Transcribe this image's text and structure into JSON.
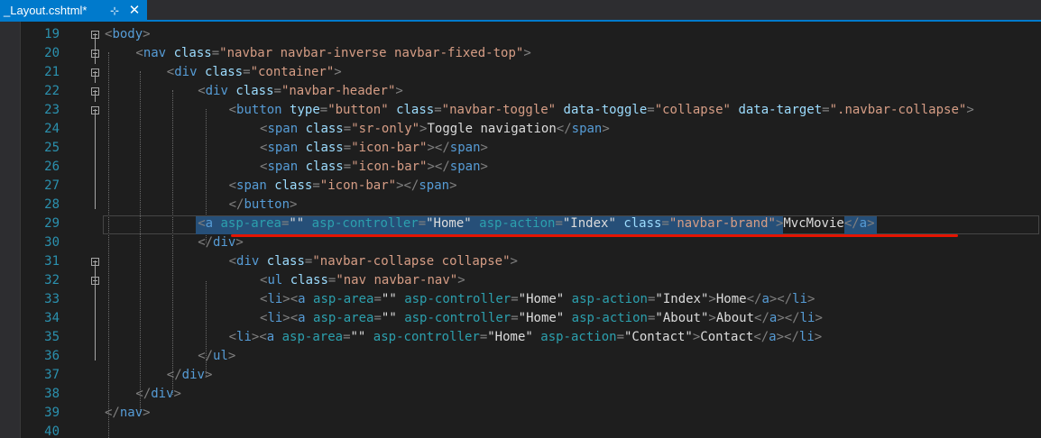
{
  "tab": {
    "title": "_Layout.cshtml*",
    "pin_glyph": "⊹",
    "close_glyph": "✕"
  },
  "colors": {
    "accent": "#007acc",
    "editor_bg": "#1e1e1e",
    "line_number": "#2b91af",
    "tag": "#569cd6",
    "attribute": "#9cdcfe",
    "attribute_value": "#d69d85",
    "selection": "#264f78",
    "underline": "#e51400"
  },
  "line_numbers": [
    "19",
    "20",
    "21",
    "22",
    "23",
    "24",
    "25",
    "26",
    "27",
    "28",
    "29",
    "30",
    "31",
    "32",
    "33",
    "34",
    "35",
    "36",
    "37",
    "38",
    "39",
    "40"
  ],
  "lines": [
    [
      {
        "c": "d",
        "t": "<"
      },
      {
        "c": "t",
        "t": "body"
      },
      {
        "c": "d",
        "t": ">"
      }
    ],
    [
      {
        "c": "d",
        "t": "<"
      },
      {
        "c": "t",
        "t": "nav"
      },
      {
        "c": "tx",
        "t": " "
      },
      {
        "c": "a",
        "t": "class"
      },
      {
        "c": "d",
        "t": "="
      },
      {
        "c": "v",
        "t": "\"navbar navbar-inverse navbar-fixed-top\""
      },
      {
        "c": "d",
        "t": ">"
      }
    ],
    [
      {
        "c": "d",
        "t": "<"
      },
      {
        "c": "t",
        "t": "div"
      },
      {
        "c": "tx",
        "t": " "
      },
      {
        "c": "a",
        "t": "class"
      },
      {
        "c": "d",
        "t": "="
      },
      {
        "c": "v",
        "t": "\"container\""
      },
      {
        "c": "d",
        "t": ">"
      }
    ],
    [
      {
        "c": "d",
        "t": "<"
      },
      {
        "c": "t",
        "t": "div"
      },
      {
        "c": "tx",
        "t": " "
      },
      {
        "c": "a",
        "t": "class"
      },
      {
        "c": "d",
        "t": "="
      },
      {
        "c": "v",
        "t": "\"navbar-header\""
      },
      {
        "c": "d",
        "t": ">"
      }
    ],
    [
      {
        "c": "d",
        "t": "<"
      },
      {
        "c": "t",
        "t": "button"
      },
      {
        "c": "tx",
        "t": " "
      },
      {
        "c": "a",
        "t": "type"
      },
      {
        "c": "d",
        "t": "="
      },
      {
        "c": "v",
        "t": "\"button\""
      },
      {
        "c": "tx",
        "t": " "
      },
      {
        "c": "a",
        "t": "class"
      },
      {
        "c": "d",
        "t": "="
      },
      {
        "c": "v",
        "t": "\"navbar-toggle\""
      },
      {
        "c": "tx",
        "t": " "
      },
      {
        "c": "a",
        "t": "data-toggle"
      },
      {
        "c": "d",
        "t": "="
      },
      {
        "c": "v",
        "t": "\"collapse\""
      },
      {
        "c": "tx",
        "t": " "
      },
      {
        "c": "a",
        "t": "data-target"
      },
      {
        "c": "d",
        "t": "="
      },
      {
        "c": "v",
        "t": "\".navbar-collapse\""
      },
      {
        "c": "d",
        "t": ">"
      }
    ],
    [
      {
        "c": "d",
        "t": "<"
      },
      {
        "c": "t",
        "t": "span"
      },
      {
        "c": "tx",
        "t": " "
      },
      {
        "c": "a",
        "t": "class"
      },
      {
        "c": "d",
        "t": "="
      },
      {
        "c": "v",
        "t": "\"sr-only\""
      },
      {
        "c": "d",
        "t": ">"
      },
      {
        "c": "tx",
        "t": "Toggle navigation"
      },
      {
        "c": "d",
        "t": "</"
      },
      {
        "c": "t",
        "t": "span"
      },
      {
        "c": "d",
        "t": ">"
      }
    ],
    [
      {
        "c": "d",
        "t": "<"
      },
      {
        "c": "t",
        "t": "span"
      },
      {
        "c": "tx",
        "t": " "
      },
      {
        "c": "a",
        "t": "class"
      },
      {
        "c": "d",
        "t": "="
      },
      {
        "c": "v",
        "t": "\"icon-bar\""
      },
      {
        "c": "d",
        "t": "></"
      },
      {
        "c": "t",
        "t": "span"
      },
      {
        "c": "d",
        "t": ">"
      }
    ],
    [
      {
        "c": "d",
        "t": "<"
      },
      {
        "c": "t",
        "t": "span"
      },
      {
        "c": "tx",
        "t": " "
      },
      {
        "c": "a",
        "t": "class"
      },
      {
        "c": "d",
        "t": "="
      },
      {
        "c": "v",
        "t": "\"icon-bar\""
      },
      {
        "c": "d",
        "t": "></"
      },
      {
        "c": "t",
        "t": "span"
      },
      {
        "c": "d",
        "t": ">"
      }
    ],
    [
      {
        "c": "d",
        "t": "<"
      },
      {
        "c": "t",
        "t": "span"
      },
      {
        "c": "tx",
        "t": " "
      },
      {
        "c": "a",
        "t": "class"
      },
      {
        "c": "d",
        "t": "="
      },
      {
        "c": "v",
        "t": "\"icon-bar\""
      },
      {
        "c": "d",
        "t": "></"
      },
      {
        "c": "t",
        "t": "span"
      },
      {
        "c": "d",
        "t": ">"
      }
    ],
    [
      {
        "c": "d",
        "t": "</"
      },
      {
        "c": "t",
        "t": "button"
      },
      {
        "c": "d",
        "t": ">"
      }
    ],
    [
      {
        "c": "d",
        "t": "<"
      },
      {
        "c": "t",
        "t": "a"
      },
      {
        "c": "tx",
        "t": " "
      },
      {
        "c": "h",
        "t": "asp-area"
      },
      {
        "c": "d",
        "t": "="
      },
      {
        "c": "tx",
        "t": "\"\""
      },
      {
        "c": "tx",
        "t": " "
      },
      {
        "c": "h",
        "t": "asp-controller"
      },
      {
        "c": "d",
        "t": "="
      },
      {
        "c": "tx",
        "t": "\"Home\""
      },
      {
        "c": "tx",
        "t": " "
      },
      {
        "c": "h",
        "t": "asp-action"
      },
      {
        "c": "d",
        "t": "="
      },
      {
        "c": "tx",
        "t": "\"Index\""
      },
      {
        "c": "tx",
        "t": " "
      },
      {
        "c": "a",
        "t": "class"
      },
      {
        "c": "d",
        "t": "="
      },
      {
        "c": "v",
        "t": "\"navbar-brand\""
      },
      {
        "c": "d",
        "t": ">"
      },
      {
        "c": "tx",
        "t": "MvcMovie"
      },
      {
        "c": "d",
        "t": "</"
      },
      {
        "c": "t",
        "t": "a"
      },
      {
        "c": "d",
        "t": ">"
      }
    ],
    [
      {
        "c": "d",
        "t": "</"
      },
      {
        "c": "t",
        "t": "div"
      },
      {
        "c": "d",
        "t": ">"
      }
    ],
    [
      {
        "c": "d",
        "t": "<"
      },
      {
        "c": "t",
        "t": "div"
      },
      {
        "c": "tx",
        "t": " "
      },
      {
        "c": "a",
        "t": "class"
      },
      {
        "c": "d",
        "t": "="
      },
      {
        "c": "v",
        "t": "\"navbar-collapse collapse\""
      },
      {
        "c": "d",
        "t": ">"
      }
    ],
    [
      {
        "c": "d",
        "t": "<"
      },
      {
        "c": "t",
        "t": "ul"
      },
      {
        "c": "tx",
        "t": " "
      },
      {
        "c": "a",
        "t": "class"
      },
      {
        "c": "d",
        "t": "="
      },
      {
        "c": "v",
        "t": "\"nav navbar-nav\""
      },
      {
        "c": "d",
        "t": ">"
      }
    ],
    [
      {
        "c": "d",
        "t": "<"
      },
      {
        "c": "t",
        "t": "li"
      },
      {
        "c": "d",
        "t": "><"
      },
      {
        "c": "t",
        "t": "a"
      },
      {
        "c": "tx",
        "t": " "
      },
      {
        "c": "h",
        "t": "asp-area"
      },
      {
        "c": "d",
        "t": "="
      },
      {
        "c": "tx",
        "t": "\"\""
      },
      {
        "c": "tx",
        "t": " "
      },
      {
        "c": "h",
        "t": "asp-controller"
      },
      {
        "c": "d",
        "t": "="
      },
      {
        "c": "tx",
        "t": "\"Home\""
      },
      {
        "c": "tx",
        "t": " "
      },
      {
        "c": "h",
        "t": "asp-action"
      },
      {
        "c": "d",
        "t": "="
      },
      {
        "c": "tx",
        "t": "\"Index\""
      },
      {
        "c": "d",
        "t": ">"
      },
      {
        "c": "tx",
        "t": "Home"
      },
      {
        "c": "d",
        "t": "</"
      },
      {
        "c": "t",
        "t": "a"
      },
      {
        "c": "d",
        "t": "></"
      },
      {
        "c": "t",
        "t": "li"
      },
      {
        "c": "d",
        "t": ">"
      }
    ],
    [
      {
        "c": "d",
        "t": "<"
      },
      {
        "c": "t",
        "t": "li"
      },
      {
        "c": "d",
        "t": "><"
      },
      {
        "c": "t",
        "t": "a"
      },
      {
        "c": "tx",
        "t": " "
      },
      {
        "c": "h",
        "t": "asp-area"
      },
      {
        "c": "d",
        "t": "="
      },
      {
        "c": "tx",
        "t": "\"\""
      },
      {
        "c": "tx",
        "t": " "
      },
      {
        "c": "h",
        "t": "asp-controller"
      },
      {
        "c": "d",
        "t": "="
      },
      {
        "c": "tx",
        "t": "\"Home\""
      },
      {
        "c": "tx",
        "t": " "
      },
      {
        "c": "h",
        "t": "asp-action"
      },
      {
        "c": "d",
        "t": "="
      },
      {
        "c": "tx",
        "t": "\"About\""
      },
      {
        "c": "d",
        "t": ">"
      },
      {
        "c": "tx",
        "t": "About"
      },
      {
        "c": "d",
        "t": "</"
      },
      {
        "c": "t",
        "t": "a"
      },
      {
        "c": "d",
        "t": "></"
      },
      {
        "c": "t",
        "t": "li"
      },
      {
        "c": "d",
        "t": ">"
      }
    ],
    [
      {
        "c": "d",
        "t": "<"
      },
      {
        "c": "t",
        "t": "li"
      },
      {
        "c": "d",
        "t": "><"
      },
      {
        "c": "t",
        "t": "a"
      },
      {
        "c": "tx",
        "t": " "
      },
      {
        "c": "h",
        "t": "asp-area"
      },
      {
        "c": "d",
        "t": "="
      },
      {
        "c": "tx",
        "t": "\"\""
      },
      {
        "c": "tx",
        "t": " "
      },
      {
        "c": "h",
        "t": "asp-controller"
      },
      {
        "c": "d",
        "t": "="
      },
      {
        "c": "tx",
        "t": "\"Home\""
      },
      {
        "c": "tx",
        "t": " "
      },
      {
        "c": "h",
        "t": "asp-action"
      },
      {
        "c": "d",
        "t": "="
      },
      {
        "c": "tx",
        "t": "\"Contact\""
      },
      {
        "c": "d",
        "t": ">"
      },
      {
        "c": "tx",
        "t": "Contact"
      },
      {
        "c": "d",
        "t": "</"
      },
      {
        "c": "t",
        "t": "a"
      },
      {
        "c": "d",
        "t": "></"
      },
      {
        "c": "t",
        "t": "li"
      },
      {
        "c": "d",
        "t": ">"
      }
    ],
    [
      {
        "c": "d",
        "t": "</"
      },
      {
        "c": "t",
        "t": "ul"
      },
      {
        "c": "d",
        "t": ">"
      }
    ],
    [
      {
        "c": "d",
        "t": "</"
      },
      {
        "c": "t",
        "t": "div"
      },
      {
        "c": "d",
        "t": ">"
      }
    ],
    [
      {
        "c": "d",
        "t": "</"
      },
      {
        "c": "t",
        "t": "div"
      },
      {
        "c": "d",
        "t": ">"
      }
    ],
    [
      {
        "c": "d",
        "t": "</"
      },
      {
        "c": "t",
        "t": "nav"
      },
      {
        "c": "d",
        "t": ">"
      }
    ],
    []
  ]
}
